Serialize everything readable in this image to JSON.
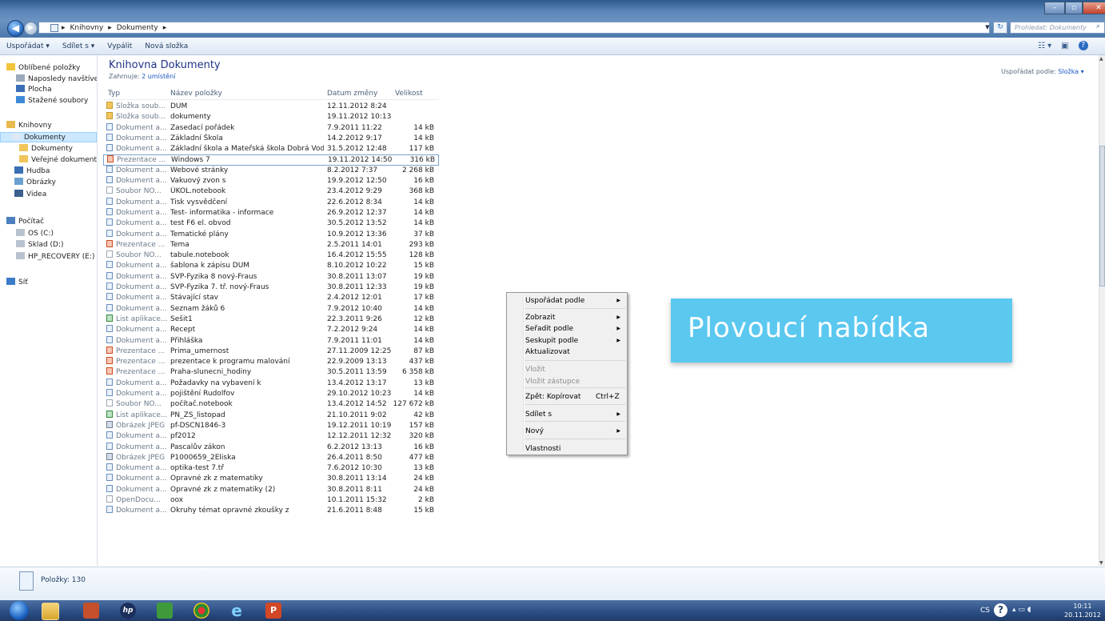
{
  "window": {
    "breadcrumb": [
      "Knihovny",
      "Dokumenty"
    ],
    "search_placeholder": "Prohledat: Dokumenty"
  },
  "toolbar": {
    "organize": "Uspořádat ▾",
    "share": "Sdílet s ▾",
    "burn": "Vypálit",
    "new_folder": "Nová složka"
  },
  "sidebar": {
    "items": [
      {
        "label": "Oblíbené položky",
        "icon": "star-icon"
      },
      {
        "label": "Naposledy navštívené",
        "icon": "recent-icon"
      },
      {
        "label": "Plocha",
        "icon": "desktop-icon"
      },
      {
        "label": "Stažené soubory",
        "icon": "downloads-icon"
      },
      {
        "label": "Knihovny",
        "icon": "libraries-icon"
      },
      {
        "label": "Dokumenty",
        "icon": "documents-icon"
      },
      {
        "label": "Dokumenty",
        "icon": "folder-icon"
      },
      {
        "label": "Veřejné dokumenty",
        "icon": "folder-icon"
      },
      {
        "label": "Hudba",
        "icon": "music-icon"
      },
      {
        "label": "Obrázky",
        "icon": "pictures-icon"
      },
      {
        "label": "Videa",
        "icon": "videos-icon"
      },
      {
        "label": "Počítač",
        "icon": "computer-icon"
      },
      {
        "label": "OS (C:)",
        "icon": "drive-icon"
      },
      {
        "label": "Sklad (D:)",
        "icon": "drive-icon"
      },
      {
        "label": "HP_RECOVERY (E:)",
        "icon": "drive-icon"
      },
      {
        "label": "Síť",
        "icon": "network-icon"
      }
    ]
  },
  "library": {
    "title": "Knihovna Dokumenty",
    "includes_label": "Zahrnuje:",
    "includes_link": "2 umístění",
    "sort_label": "Uspořádat podle:",
    "sort_value": "Složka ▾"
  },
  "columns": {
    "type": "Typ",
    "name": "Název položky",
    "date": "Datum změny",
    "size": "Velikost"
  },
  "files": [
    {
      "type": "Složka soub...",
      "kind": "folder",
      "name": "DUM",
      "date": "12.11.2012 8:24",
      "size": ""
    },
    {
      "type": "Složka soub...",
      "kind": "folder",
      "name": "dokumenty",
      "date": "19.11.2012 10:13",
      "size": ""
    },
    {
      "type": "Dokument a...",
      "kind": "doc",
      "name": "Zasedací pořádek",
      "date": "7.9.2011 11:22",
      "size": "14 kB"
    },
    {
      "type": "Dokument a...",
      "kind": "doc",
      "name": "Základní Škola",
      "date": "14.2.2012 9:17",
      "size": "14 kB"
    },
    {
      "type": "Dokument a...",
      "kind": "doc",
      "name": "Základní škola a Mateřská škola Dobrá Voda u ...",
      "date": "31.5.2012 12:48",
      "size": "117 kB"
    },
    {
      "type": "Prezentace ...",
      "kind": "ppt",
      "name": "Windows 7",
      "date": "19.11.2012 14:50",
      "size": "316 kB"
    },
    {
      "type": "Dokument a...",
      "kind": "doc",
      "name": "Webové stránky",
      "date": "8.2.2012 7:37",
      "size": "2 268 kB"
    },
    {
      "type": "Dokument a...",
      "kind": "doc",
      "name": "Vakuový zvon s",
      "date": "19.9.2012 12:50",
      "size": "16 kB"
    },
    {
      "type": "Soubor NO...",
      "kind": "blank",
      "name": "ÚKOL.notebook",
      "date": "23.4.2012 9:29",
      "size": "368 kB"
    },
    {
      "type": "Dokument a...",
      "kind": "doc",
      "name": "Tisk vysvědčení",
      "date": "22.6.2012 8:34",
      "size": "14 kB"
    },
    {
      "type": "Dokument a...",
      "kind": "doc",
      "name": "Test- informatika - informace",
      "date": "26.9.2012 12:37",
      "size": "14 kB"
    },
    {
      "type": "Dokument a...",
      "kind": "doc",
      "name": "test F6 el. obvod",
      "date": "30.5.2012 13:52",
      "size": "14 kB"
    },
    {
      "type": "Dokument a...",
      "kind": "doc",
      "name": "Tematické plány",
      "date": "10.9.2012 13:36",
      "size": "37 kB"
    },
    {
      "type": "Prezentace ...",
      "kind": "ppt",
      "name": "Tema",
      "date": "2.5.2011 14:01",
      "size": "293 kB"
    },
    {
      "type": "Soubor NO...",
      "kind": "blank",
      "name": "tabule.notebook",
      "date": "16.4.2012 15:55",
      "size": "128 kB"
    },
    {
      "type": "Dokument a...",
      "kind": "doc",
      "name": "šablona k zápisu DUM",
      "date": "8.10.2012 10:22",
      "size": "15 kB"
    },
    {
      "type": "Dokument a...",
      "kind": "doc",
      "name": "SVP-Fyzika 8 nový-Fraus",
      "date": "30.8.2011 13:07",
      "size": "19 kB"
    },
    {
      "type": "Dokument a...",
      "kind": "doc",
      "name": "SVP-Fyzika 7. tř. nový-Fraus",
      "date": "30.8.2011 12:33",
      "size": "19 kB"
    },
    {
      "type": "Dokument a...",
      "kind": "doc",
      "name": "Stávající stav",
      "date": "2.4.2012 12:01",
      "size": "17 kB"
    },
    {
      "type": "Dokument a...",
      "kind": "doc",
      "name": "Seznam žáků 6",
      "date": "7.9.2012 10:40",
      "size": "14 kB"
    },
    {
      "type": "List aplikace...",
      "kind": "xls",
      "name": "Sešit1",
      "date": "22.3.2011 9:26",
      "size": "12 kB"
    },
    {
      "type": "Dokument a...",
      "kind": "doc",
      "name": "Recept",
      "date": "7.2.2012 9:24",
      "size": "14 kB"
    },
    {
      "type": "Dokument a...",
      "kind": "doc",
      "name": "Přihláška",
      "date": "7.9.2011 11:01",
      "size": "14 kB"
    },
    {
      "type": "Prezentace ...",
      "kind": "ppt",
      "name": "Prima_umernost",
      "date": "27.11.2009 12:25",
      "size": "87 kB"
    },
    {
      "type": "Prezentace ...",
      "kind": "ppt",
      "name": "prezentace k programu malování",
      "date": "22.9.2009 13:13",
      "size": "437 kB"
    },
    {
      "type": "Prezentace ...",
      "kind": "ppt",
      "name": "Praha-slunecni_hodiny",
      "date": "30.5.2011 13:59",
      "size": "6 358 kB"
    },
    {
      "type": "Dokument a...",
      "kind": "doc",
      "name": "Požadavky na vybavení  k",
      "date": "13.4.2012 13:17",
      "size": "13 kB"
    },
    {
      "type": "Dokument a...",
      "kind": "doc",
      "name": "pojištění Rudolfov",
      "date": "29.10.2012 10:23",
      "size": "14 kB"
    },
    {
      "type": "Soubor NO...",
      "kind": "blank",
      "name": "počítač.notebook",
      "date": "13.4.2012 14:52",
      "size": "127 672 kB"
    },
    {
      "type": "List aplikace...",
      "kind": "xls",
      "name": "PN_ZS_listopad",
      "date": "21.10.2011 9:02",
      "size": "42 kB"
    },
    {
      "type": "Obrázek JPEG",
      "kind": "img",
      "name": "pf-DSCN1846-3",
      "date": "19.12.2011 10:19",
      "size": "157 kB"
    },
    {
      "type": "Dokument a...",
      "kind": "doc",
      "name": "pf2012",
      "date": "12.12.2011 12:32",
      "size": "320 kB"
    },
    {
      "type": "Dokument a...",
      "kind": "doc",
      "name": "Pascalův zákon",
      "date": "6.2.2012 13:13",
      "size": "16 kB"
    },
    {
      "type": "Obrázek JPEG",
      "kind": "img",
      "name": "P1000659_2Eliska",
      "date": "26.4.2011 8:50",
      "size": "477 kB"
    },
    {
      "type": "Dokument a...",
      "kind": "doc",
      "name": "optika-test 7.tř",
      "date": "7.6.2012 10:30",
      "size": "13 kB"
    },
    {
      "type": "Dokument a...",
      "kind": "doc",
      "name": "Opravné zk z matematiky",
      "date": "30.8.2011 13:14",
      "size": "24 kB"
    },
    {
      "type": "Dokument a...",
      "kind": "doc",
      "name": "Opravné zk z matematiky (2)",
      "date": "30.8.2011 8:11",
      "size": "24 kB"
    },
    {
      "type": "OpenDocu...",
      "kind": "blank",
      "name": "oox",
      "date": "10.1.2011 15:32",
      "size": "2 kB"
    },
    {
      "type": "Dokument a...",
      "kind": "doc",
      "name": "Okruhy témat opravné zkoušky z",
      "date": "21.6.2011 8:48",
      "size": "15 kB"
    }
  ],
  "context_menu": {
    "items": [
      {
        "label": "Uspořádat podle",
        "submenu": true,
        "disabled": false
      },
      {
        "label": "Zobrazit",
        "submenu": true,
        "disabled": false
      },
      {
        "label": "Seřadit podle",
        "submenu": true,
        "disabled": false
      },
      {
        "label": "Seskupit podle",
        "submenu": true,
        "disabled": false
      },
      {
        "label": "Aktualizovat",
        "submenu": false,
        "disabled": false
      },
      {
        "label": "Vložit",
        "submenu": false,
        "disabled": true
      },
      {
        "label": "Vložit zástupce",
        "submenu": false,
        "disabled": true
      },
      {
        "label": "Zpět: Kopírovat",
        "shortcut": "Ctrl+Z",
        "submenu": false,
        "disabled": false
      },
      {
        "label": "Sdílet s",
        "submenu": true,
        "disabled": false
      },
      {
        "label": "Nový",
        "submenu": true,
        "disabled": false
      },
      {
        "label": "Vlastnosti",
        "submenu": false,
        "disabled": false
      }
    ]
  },
  "callout": {
    "text": "Plovoucí nabídka"
  },
  "details": {
    "count": "Položky: 130"
  },
  "taskbar": {
    "language": "CS",
    "time": "10:11",
    "date": "20.11.2012"
  }
}
